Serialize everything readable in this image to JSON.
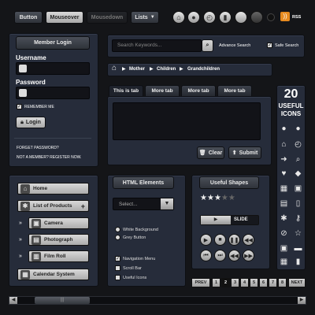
{
  "toolbar": {
    "button": "Button",
    "mouseover": "Mouseover",
    "mousedown": "Mousedown",
    "lists": "Lists",
    "rss": "RSS",
    "icons": [
      "home-icon",
      "user-icon",
      "clock-icon",
      "chart-icon",
      "circle-icon",
      "circle-dark-icon",
      "dot-icon"
    ]
  },
  "login": {
    "header": "Member Login",
    "username_label": "Username",
    "password_label": "Password",
    "remember": "REMEMBER ME",
    "login_button": "Login",
    "forgot": "FORGET PASSWORD?",
    "register": "NOT A MEMBER? REGISTER NOW."
  },
  "search": {
    "placeholder": "Search Keywords...",
    "advanced": "Advance Search",
    "safe": "Safe Search"
  },
  "breadcrumb": [
    "Mother",
    "Children",
    "Grandchildren"
  ],
  "tabs": [
    "This is tab",
    "More tab",
    "More tab",
    "More tab"
  ],
  "form": {
    "clear": "Clear",
    "submit": "Submit"
  },
  "icons_panel": {
    "count": "20",
    "title1": "USEFUL",
    "title2": "ICONS"
  },
  "nav": {
    "home": "Home",
    "products": "List of Products",
    "camera": "Camera",
    "photograph": "Photograph",
    "film": "Film Roll",
    "calendar": "Calendar System"
  },
  "html_elements": {
    "header": "HTML Elements",
    "select": "Select...",
    "radio1": "White Background",
    "radio2": "Grey Button",
    "check1": "Navigation Menu",
    "check2": "Scroll Bar",
    "check3": "Useful Icons"
  },
  "shapes": {
    "header": "Useful Shapes",
    "rating": 3,
    "rating_max": 5,
    "slide": "SLIDE"
  },
  "pagination": {
    "prev": "PREV",
    "pages": [
      "1",
      "2",
      "3",
      "4",
      "5",
      "6",
      "7",
      "8"
    ],
    "next": "NEXT"
  }
}
